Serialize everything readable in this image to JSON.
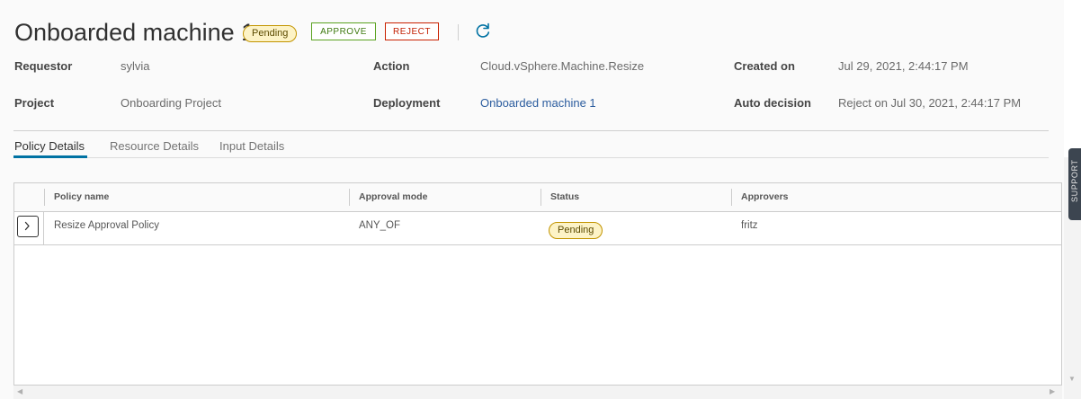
{
  "header": {
    "title": "Onboarded machine 1",
    "status_badge": "Pending",
    "approve_label": "APPROVE",
    "reject_label": "REJECT",
    "refresh_icon": "refresh-icon"
  },
  "details": {
    "requestor_label": "Requestor",
    "requestor_value": "sylvia",
    "project_label": "Project",
    "project_value": "Onboarding Project",
    "action_label": "Action",
    "action_value": "Cloud.vSphere.Machine.Resize",
    "deployment_label": "Deployment",
    "deployment_value": "Onboarded machine 1",
    "created_label": "Created on",
    "created_value": "Jul 29, 2021, 2:44:17 PM",
    "auto_label": "Auto decision",
    "auto_value": "Reject on Jul 30, 2021, 2:44:17 PM"
  },
  "tabs": [
    {
      "label": "Policy Details",
      "active": true
    },
    {
      "label": "Resource Details",
      "active": false
    },
    {
      "label": "Input Details",
      "active": false
    }
  ],
  "grid": {
    "columns": [
      "Policy name",
      "Approval mode",
      "Status",
      "Approvers"
    ],
    "rows": [
      {
        "policy_name": "Resize Approval Policy",
        "approval_mode": "ANY_OF",
        "status": "Pending",
        "approvers": "fritz"
      }
    ]
  },
  "support_label": "SUPPORT",
  "colors": {
    "accent": "#0072a3",
    "approve": "#3e7a10",
    "reject": "#c21d00",
    "pending_bg": "#fdf3c6",
    "link": "#2b5c9e"
  }
}
